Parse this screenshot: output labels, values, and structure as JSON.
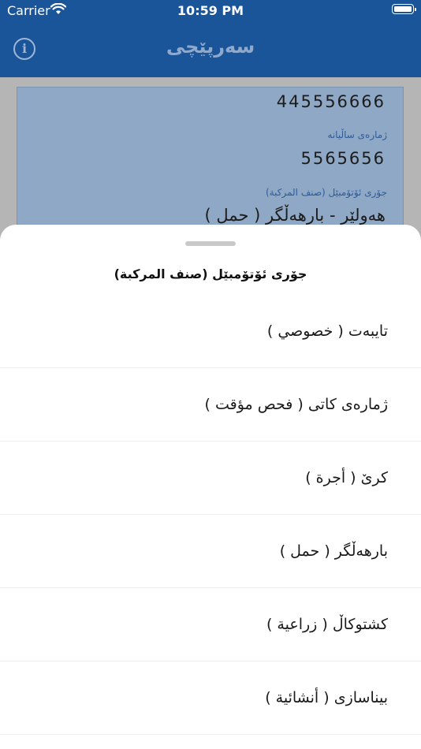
{
  "status_bar": {
    "carrier": "Carrier",
    "time": "10:59 PM"
  },
  "nav": {
    "title": "سەرپێچی",
    "info_icon": "info-icon"
  },
  "card": {
    "top_value": "445556666",
    "year_label": "ژمارەی ساڵیانە",
    "year_value": "5565656",
    "type_label": "جۆری ئۆتۆمبێل (صنف المركبة)",
    "type_value": "هەولێر - بارهەڵگر ( حمل )"
  },
  "sheet": {
    "title": "جۆری ئۆتۆمبێل (صنف المركبة)",
    "options": [
      {
        "label": "تایبەت ( خصوصي )"
      },
      {
        "label": "ژمارەی کاتی ( فحص مؤقت )"
      },
      {
        "label": "کرێ ( أجرة )"
      },
      {
        "label": "بارهەڵگر ( حمل )"
      },
      {
        "label": "کشتوکاڵ ( زراعية )"
      },
      {
        "label": "بیناسازی ( أنشائية )"
      }
    ]
  }
}
